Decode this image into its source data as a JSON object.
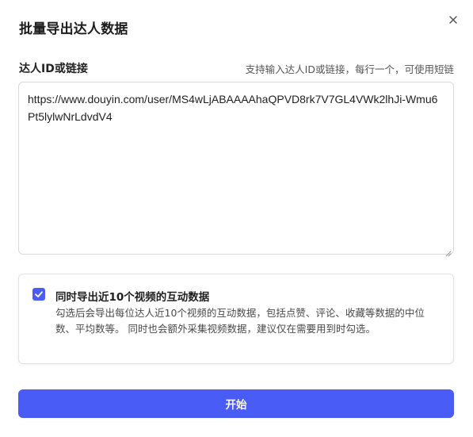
{
  "dialog": {
    "title": "批量导出达人数据",
    "close_icon": "close-icon"
  },
  "input": {
    "label": "达人ID或链接",
    "hint": "支持输入达人ID或链接，每行一个，可使用短链",
    "value": "https://www.douyin.com/user/MS4wLjABAAAAhaQPVD8rk7V7GL4VWk2lhJi-Wmu6Pt5lylwNrLdvdV4"
  },
  "option": {
    "checked": true,
    "title": "同时导出近10个视频的互动数据",
    "description": "勾选后会导出每位达人近10个视频的互动数据，包括点赞、评论、收藏等数据的中位数、平均数等。 同时也会额外采集视频数据，建议仅在需要用到时勾选。"
  },
  "actions": {
    "start_label": "开始"
  },
  "colors": {
    "accent": "#4a5cf6",
    "border": "#d9d9d9"
  }
}
